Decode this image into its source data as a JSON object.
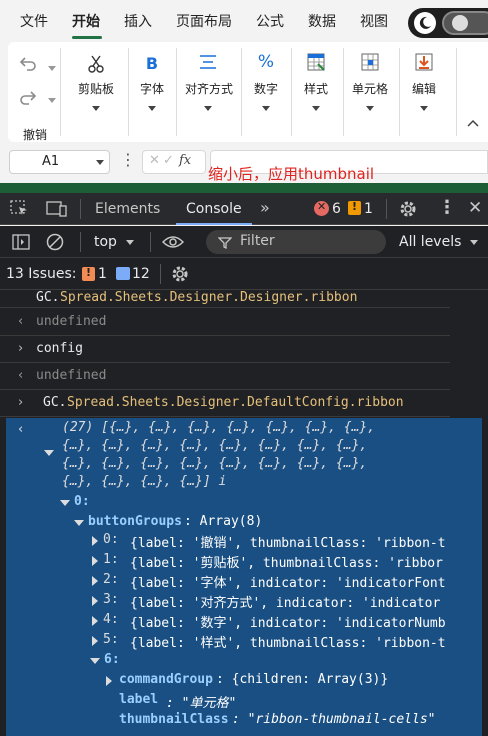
{
  "menu_tabs": [
    "文件",
    "开始",
    "插入",
    "页面布局",
    "公式",
    "数据",
    "视图"
  ],
  "ribbon": {
    "groups": [
      {
        "label": "撤销"
      },
      {
        "label": "剪贴板"
      },
      {
        "label": "字体"
      },
      {
        "label": "对齐方式"
      },
      {
        "label": "数字"
      },
      {
        "label": "样式"
      },
      {
        "label": "单元格"
      },
      {
        "label": "编辑"
      }
    ]
  },
  "formula_bar": {
    "name_box": "A1",
    "fx": "fx"
  },
  "annotation": "缩小后，应用thumbnail",
  "devtools": {
    "tabs": [
      "Elements",
      "Console"
    ],
    "error_count": "6",
    "warning_count": "1",
    "context": "top",
    "filter_placeholder": "Filter",
    "levels": "All levels",
    "issues_label": "13 Issues:",
    "issues_warn": "1",
    "issues_info": "12"
  },
  "console": {
    "line1_prefix": "GC.",
    "line1_rest": "Spread.Sheets.Designer.Designer.ribbon",
    "line2": "undefined",
    "line3": "config",
    "line4": "undefined",
    "line5_prefix": "GC.",
    "line5_rest": "Spread.Sheets.Designer.DefaultConfig.ribbon",
    "array_line1": "(27) [{…}, {…}, {…}, {…}, {…}, {…}, {…},",
    "array_line2": "{…}, {…}, {…}, {…}, {…}, {…}, {…}, {…},",
    "array_line3": "{…}, {…}, {…}, {…}, {…}, {…}, {…}, {…},",
    "array_line4": "{…}, {…}, {…}, {…}] i",
    "idx0": "0:",
    "buttonGroups_key": "buttonGroups",
    "buttonGroups_val": ": Array(8)",
    "items": [
      {
        "idx": "0:",
        "text": "{label: '撤销', thumbnailClass: 'ribbon-t"
      },
      {
        "idx": "1:",
        "text": "{label: '剪贴板', thumbnailClass: 'ribbor"
      },
      {
        "idx": "2:",
        "text": "{label: '字体', indicator: 'indicatorFont"
      },
      {
        "idx": "3:",
        "text": "{label: '对齐方式', indicator: 'indicator"
      },
      {
        "idx": "4:",
        "text": "{label: '数字', indicator: 'indicatorNumb"
      },
      {
        "idx": "5:",
        "text": "{label: '样式', thumbnailClass: 'ribbon-t"
      }
    ],
    "idx6": "6:",
    "commandGroup_key": "commandGroup",
    "commandGroup_val": ": {children: Array(3)}",
    "label_key": "label",
    "label_val": ": \"单元格\"",
    "thumb_key": "thumbnailClass",
    "thumb_val": ": \"ribbon-thumbnail-cells\""
  },
  "colors": {
    "accent_green": "#217346",
    "devtools_bg": "#202124",
    "selection_blue": "#1a4f84",
    "console_tab_underline": "#7cacf8",
    "error_red": "#e0231f"
  }
}
